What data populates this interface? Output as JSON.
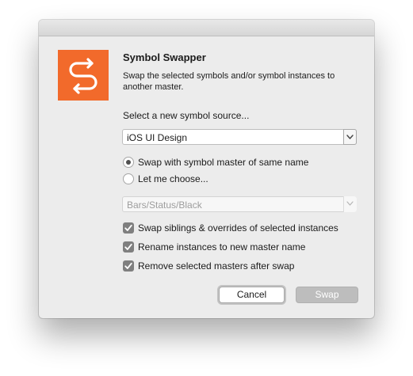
{
  "dialog": {
    "title": "Symbol Swapper",
    "description": "Swap the selected symbols and/or symbol instances to another master.",
    "icon_name": "swap-arrows-icon",
    "accent_color": "#f26a2b"
  },
  "source": {
    "label": "Select a new symbol source...",
    "selected": "iOS UI Design"
  },
  "options": {
    "radio_same_name": "Swap with symbol master of same name",
    "radio_same_name_checked": true,
    "radio_choose": "Let me choose...",
    "radio_choose_checked": false,
    "master_select_value": "Bars/Status/Black"
  },
  "checkboxes": {
    "siblings": "Swap siblings & overrides of selected instances",
    "rename": "Rename instances to new master name",
    "remove": "Remove selected masters after swap"
  },
  "buttons": {
    "cancel": "Cancel",
    "swap": "Swap"
  }
}
